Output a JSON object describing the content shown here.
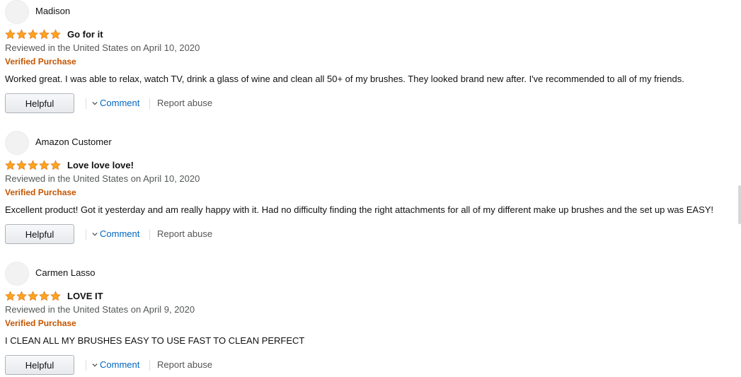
{
  "colors": {
    "star": "#ffa41c",
    "verified": "#c45500",
    "link": "#0066c0"
  },
  "reviews": [
    {
      "reviewer": "Madison",
      "rating": 5,
      "title": "Go for it",
      "meta": "Reviewed in the United States on April 10, 2020",
      "verified": "Verified Purchase",
      "body": "Worked great. I was able to relax, watch TV, drink a glass of wine and clean all 50+ of my brushes. They looked brand new after. I've recommended to all of my friends.",
      "helpful_label": "Helpful",
      "comment_label": "Comment",
      "report_label": "Report abuse"
    },
    {
      "reviewer": "Amazon Customer",
      "rating": 5,
      "title": "Love love love!",
      "meta": "Reviewed in the United States on April 10, 2020",
      "verified": "Verified Purchase",
      "body": "Excellent product! Got it yesterday and am really happy with it. Had no difficulty finding the right attachments for all of my different make up brushes and the set up was EASY!",
      "helpful_label": "Helpful",
      "comment_label": "Comment",
      "report_label": "Report abuse"
    },
    {
      "reviewer": "Carmen Lasso",
      "rating": 5,
      "title": "LOVE IT",
      "meta": "Reviewed in the United States on April 9, 2020",
      "verified": "Verified Purchase",
      "body": "I CLEAN ALL MY BRUSHES EASY TO USE FAST TO CLEAN PERFECT",
      "helpful_label": "Helpful",
      "comment_label": "Comment",
      "report_label": "Report abuse"
    }
  ],
  "icons": {
    "star": "star-icon",
    "avatar": "avatar",
    "comment_chevron": "chevron-down-icon"
  }
}
